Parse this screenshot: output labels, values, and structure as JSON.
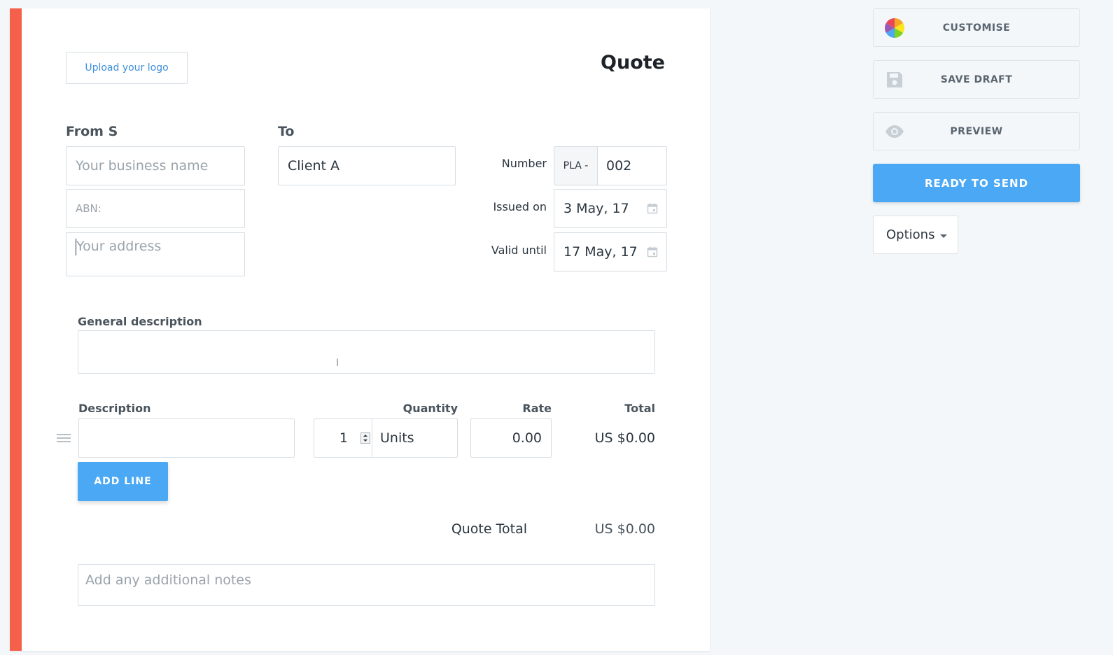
{
  "document": {
    "title": "Quote",
    "upload_logo_label": "Upload your logo",
    "from_label": "From S",
    "to_label": "To",
    "business_name_placeholder": "Your business name",
    "abn_placeholder": "ABN:",
    "address_placeholder": "Your address",
    "client_value": "Client A",
    "number_label": "Number",
    "number_prefix": "PLA -",
    "number_value": "002",
    "issued_label": "Issued on",
    "issued_value": "3 May, 17",
    "valid_label": "Valid until",
    "valid_value": "17 May, 17",
    "general_description_label": "General description",
    "columns": {
      "description": "Description",
      "quantity": "Quantity",
      "rate": "Rate",
      "total": "Total"
    },
    "line_item": {
      "description": "",
      "quantity": "1",
      "unit": "Units",
      "rate": "0.00",
      "total": "US $0.00"
    },
    "add_line_label": "ADD LINE",
    "quote_total_label": "Quote Total",
    "quote_total_value": "US $0.00",
    "notes_placeholder": "Add any additional notes"
  },
  "sidebar": {
    "customise_label": "CUSTOMISE",
    "save_draft_label": "SAVE DRAFT",
    "preview_label": "PREVIEW",
    "ready_label": "READY TO SEND",
    "options_label": "Options"
  },
  "colors": {
    "accent_bar": "#f5604a",
    "primary": "#4aa8f5",
    "link": "#3d8fd9"
  }
}
